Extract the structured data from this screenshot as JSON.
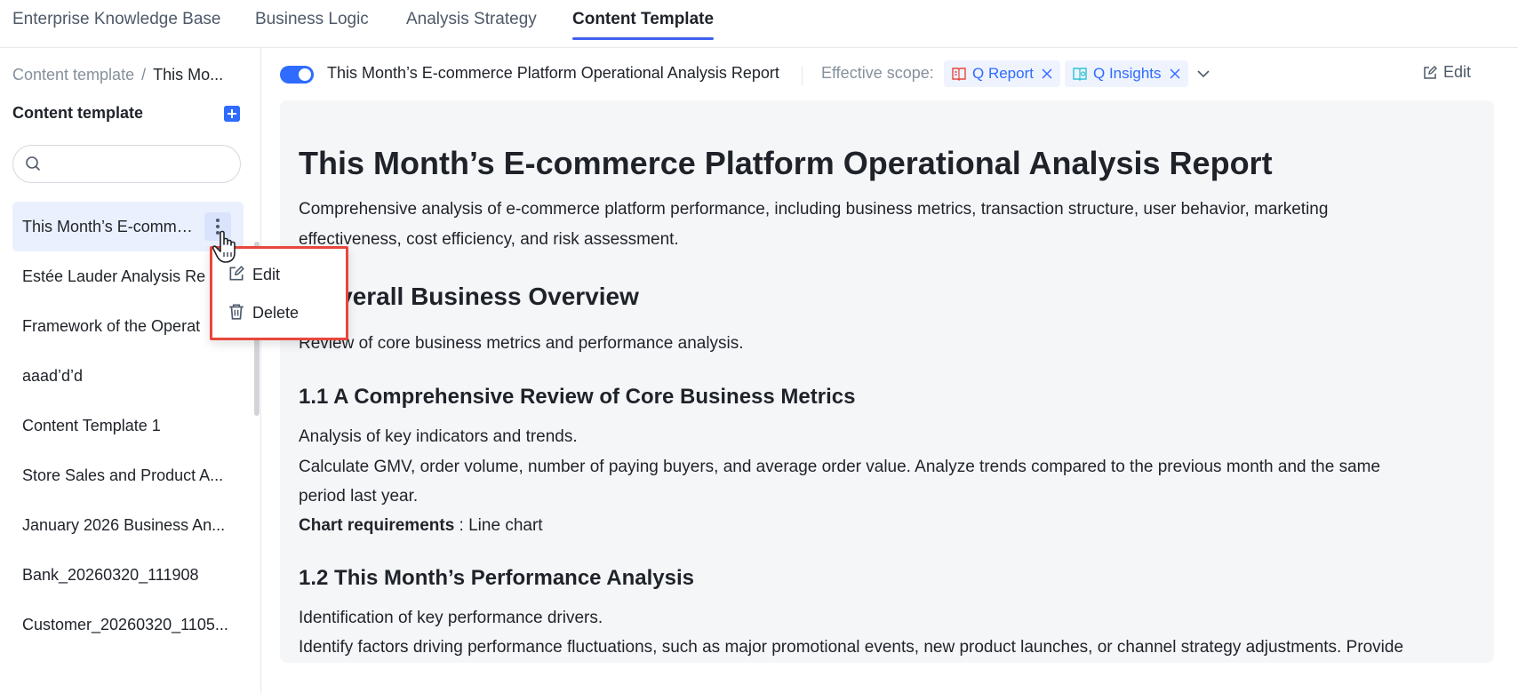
{
  "top_tabs": [
    {
      "label": "Enterprise Knowledge Base",
      "active": false
    },
    {
      "label": "Business Logic",
      "active": false
    },
    {
      "label": "Analysis Strategy",
      "active": false
    },
    {
      "label": "Content Template",
      "active": true
    }
  ],
  "sidebar": {
    "breadcrumb_root": "Content template",
    "breadcrumb_sep": "/",
    "breadcrumb_current": "This Mo...",
    "title": "Content template",
    "add_icon": "plus-square-icon",
    "search_placeholder": "",
    "items": [
      {
        "label": "This Month’s E-commerce Platform Operational Analysis Report",
        "selected": true
      },
      {
        "label": "Estée Lauder Analysis Re"
      },
      {
        "label": "Framework of the Operat"
      },
      {
        "label": "aaad’d’d"
      },
      {
        "label": "Content Template 1"
      },
      {
        "label": "Store Sales and Product A..."
      },
      {
        "label": "January 2026 Business An..."
      },
      {
        "label": "Bank_20260320_111908"
      },
      {
        "label": "Customer_20260320_1105..."
      }
    ]
  },
  "context_menu": {
    "items": [
      {
        "label": "Edit",
        "icon": "edit-icon"
      },
      {
        "label": "Delete",
        "icon": "trash-icon"
      }
    ]
  },
  "header": {
    "toggle_on": true,
    "title": "This Month’s E-commerce Platform Operational Analysis Report",
    "scope_label": "Effective scope:",
    "chips": [
      {
        "label": "Q Report",
        "icon": "report-icon",
        "color": "#e8473c"
      },
      {
        "label": "Q Insights",
        "icon": "insights-icon",
        "color": "#2fc2d6"
      }
    ],
    "edit_label": "Edit"
  },
  "document": {
    "title": "This Month’s E-commerce Platform Operational Analysis Report",
    "intro_line1": "Comprehensive analysis of e-commerce platform performance, including business metrics, transaction structure, user behavior, marketing",
    "intro_line2": "effectiveness, cost efficiency, and risk assessment.",
    "section1_title": "1 Overall Business Overview",
    "section1_desc": "Review of core business metrics and performance analysis.",
    "sub11_title": "1.1 A Comprehensive Review of Core Business Metrics",
    "sub11_line1": "Analysis of key indicators and trends.",
    "sub11_line2": "Calculate GMV, order volume, number of paying buyers, and average order value. Analyze trends compared to the previous month and the same",
    "sub11_line3": "period last year.",
    "sub11_chart_label": "Chart requirements",
    "sub11_chart_value": " : Line chart",
    "sub12_title": "1.2 This Month’s Performance Analysis",
    "sub12_line1": "Identification of key performance drivers.",
    "sub12_line2": "Identify factors driving performance fluctuations, such as major promotional events, new product launches, or channel strategy adjustments. Provide"
  },
  "colors": {
    "accent": "#2f6bff",
    "tab_underline": "#4060f0",
    "menu_border": "#e8473c"
  }
}
